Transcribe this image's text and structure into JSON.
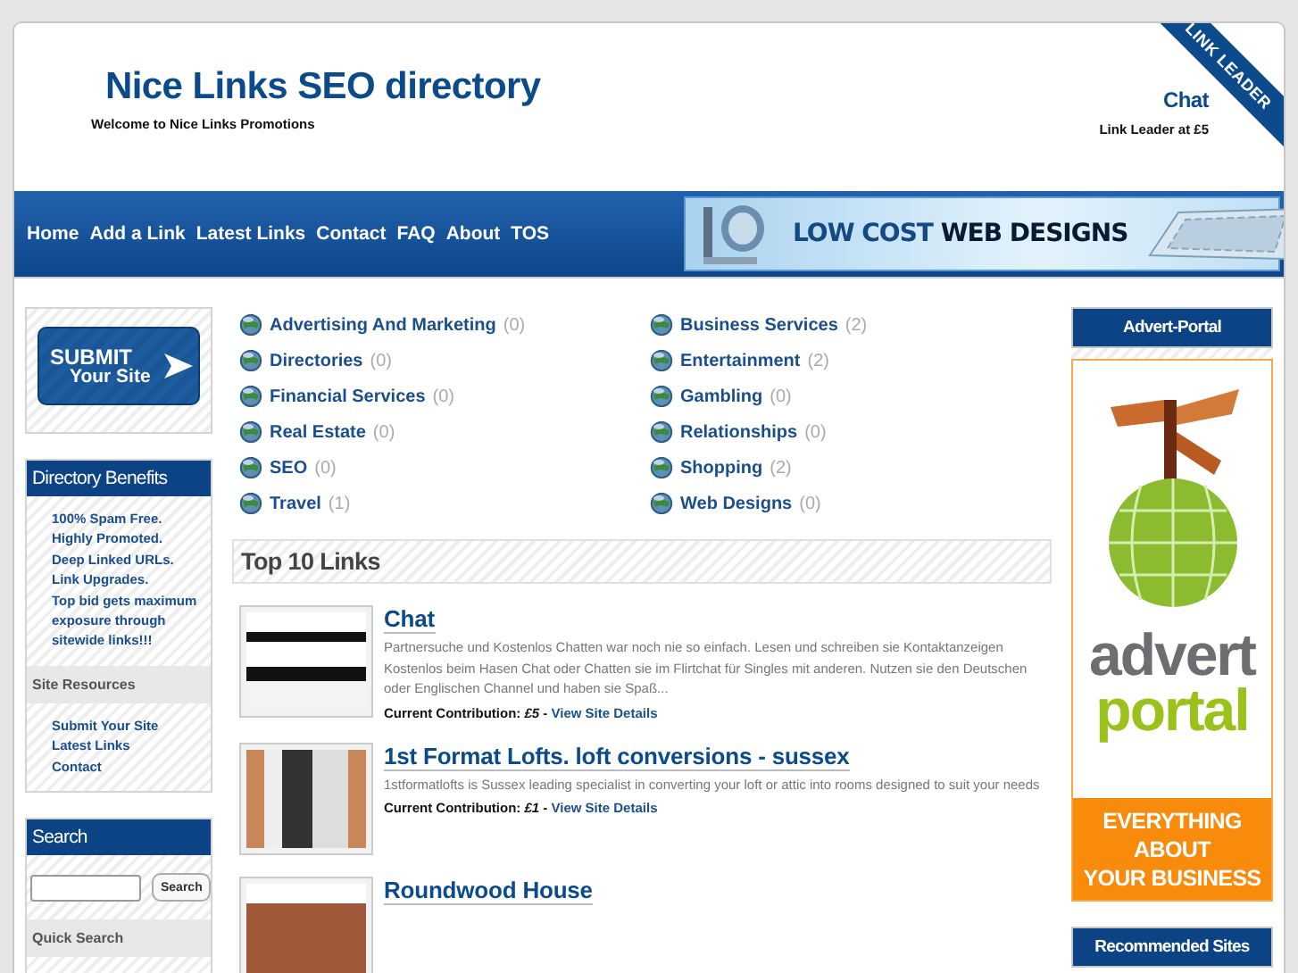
{
  "header": {
    "title": "Nice Links SEO directory",
    "tagline": "Welcome to Nice Links Promotions",
    "featured_link": "Chat",
    "featured_caption": "Link Leader at £5",
    "ribbon": "LINK LEADER"
  },
  "nav": {
    "items": [
      "Home",
      "Add a Link",
      "Latest Links",
      "Contact",
      "FAQ",
      "About",
      "TOS"
    ],
    "banner": {
      "highlight": "LOW COST",
      "text": "WEB DESIGNS"
    }
  },
  "left_sidebar": {
    "submit_button": {
      "line_1": "SUBMIT",
      "line_2": "Your Site"
    },
    "benefits": {
      "title": "Directory Benefits",
      "items": [
        "100% Spam Free.",
        "Highly Promoted.",
        "Deep Linked URLs.",
        "Link Upgrades.",
        "Top bid gets maximum exposure through sitewide links!!!"
      ]
    },
    "resources": {
      "title": "Site Resources",
      "items": [
        "Submit Your Site",
        "Latest Links",
        "Contact"
      ]
    },
    "search": {
      "title": "Search",
      "button": "Search",
      "quick_search": "Quick Search"
    }
  },
  "categories": [
    {
      "name": "Advertising And Marketing",
      "count": "(0)"
    },
    {
      "name": "Business Services",
      "count": "(2)"
    },
    {
      "name": "Directories",
      "count": "(0)"
    },
    {
      "name": "Entertainment",
      "count": "(2)"
    },
    {
      "name": "Financial Services",
      "count": "(0)"
    },
    {
      "name": "Gambling",
      "count": "(0)"
    },
    {
      "name": "Real Estate",
      "count": "(0)"
    },
    {
      "name": "Relationships",
      "count": "(0)"
    },
    {
      "name": "SEO",
      "count": "(0)"
    },
    {
      "name": "Shopping",
      "count": "(2)"
    },
    {
      "name": "Travel",
      "count": "(1)"
    },
    {
      "name": "Web Designs",
      "count": "(0)"
    }
  ],
  "top_links": {
    "title": "Top 10 Links",
    "entries": [
      {
        "title": "Chat",
        "description": "Partnersuche und Kostenlos Chatten war noch nie so einfach. Lesen und schreiben sie Kontaktanzeigen Kostenlos beim Hasen Chat oder Chatten sie im Flirtchat für Singles mit anderen. Nutzen sie den Deutschen oder Englischen Channel und haben sie Spaß...",
        "contribution": "Current Contribution: *£5* -",
        "details_link": "View Site Details"
      },
      {
        "title": "1st Format Lofts. loft conversions - sussex",
        "description": "1stformatlofts is Sussex leading specialist in converting your loft or attic into rooms designed to suit your needs",
        "contribution": "Current Contribution: *£1* -",
        "details_link": "View Site Details"
      },
      {
        "title": "Roundwood House"
      }
    ]
  },
  "right_sidebar": {
    "advert": {
      "title": "Advert-Portal",
      "word_1": "advert",
      "word_2": "portal",
      "tagline_lines": [
        "EVERYTHING",
        "ABOUT",
        "YOUR BUSINESS"
      ]
    },
    "recommended": {
      "title": "Recommended Sites"
    }
  }
}
